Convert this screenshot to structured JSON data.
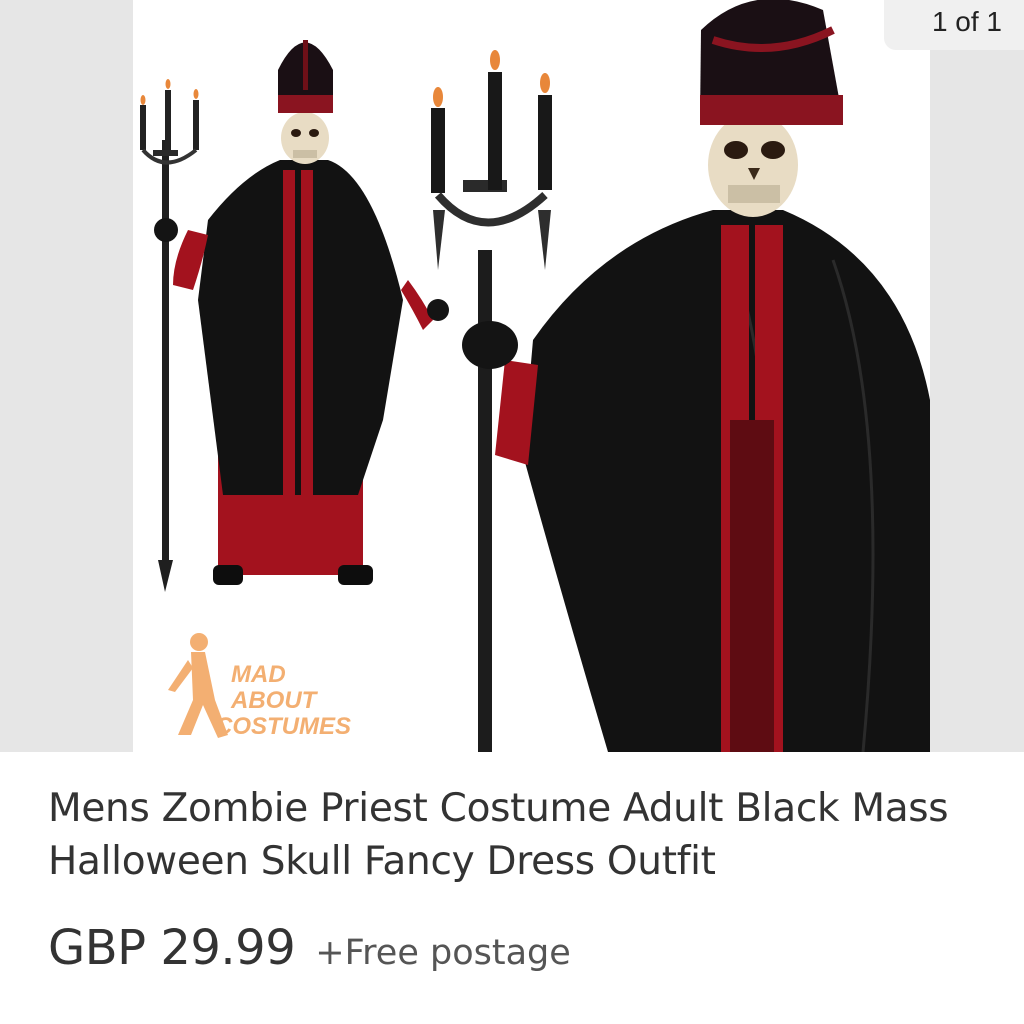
{
  "gallery": {
    "counter": "1 of 1",
    "watermark_logo_text": "MAD ABOUT COSTUMES"
  },
  "listing": {
    "title": "Mens Zombie Priest Costume Adult Black Mass Halloween Skull Fancy Dress Outfit",
    "price": "GBP 29.99",
    "postage": "+Free postage"
  },
  "colors": {
    "robe_black": "#121212",
    "robe_red": "#a3121e",
    "logo_orange": "#f2a25a",
    "skull": "#e8dcc4"
  }
}
